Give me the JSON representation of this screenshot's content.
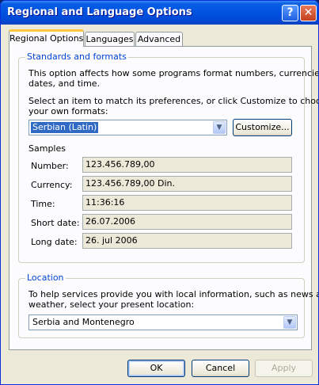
{
  "window": {
    "title": "Regional and Language Options",
    "help_icon": "?",
    "close_icon": "✕"
  },
  "tabs": [
    {
      "label": "Regional Options",
      "active": true
    },
    {
      "label": "Languages",
      "active": false
    },
    {
      "label": "Advanced",
      "active": false
    }
  ],
  "standards": {
    "legend": "Standards and formats",
    "description_line1": "This option affects how some programs format numbers, currencies,",
    "description_line2": "dates, and time.",
    "select_line1": "Select an item to match its preferences, or click Customize to choose",
    "select_line2": "your own formats:",
    "format_value": "Serbian (Latin)",
    "customize_label": "Customize...",
    "samples_heading": "Samples",
    "samples": [
      {
        "label": "Number:",
        "value": "123.456.789,00"
      },
      {
        "label": "Currency:",
        "value": "123.456.789,00 Din."
      },
      {
        "label": "Time:",
        "value": "11:36:16"
      },
      {
        "label": "Short date:",
        "value": "26.07.2006"
      },
      {
        "label": "Long date:",
        "value": "26. jul 2006"
      }
    ]
  },
  "location": {
    "legend": "Location",
    "description_line1": "To help services provide you with local information, such as news and",
    "description_line2": "weather, select your present location:",
    "value": "Serbia and Montenegro"
  },
  "buttons": {
    "ok": "OK",
    "cancel": "Cancel",
    "apply": "Apply"
  },
  "icons": {
    "dropdown_arrow": "▼"
  },
  "colors": {
    "titlebar": "#0054e3",
    "legend_text": "#0046d5",
    "selection": "#316ac5",
    "tab_highlight": "#ffc83c"
  }
}
